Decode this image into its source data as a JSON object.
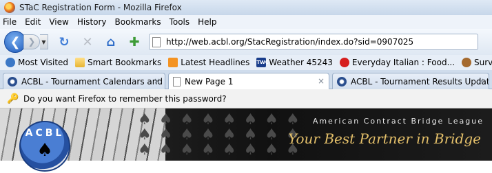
{
  "window": {
    "title": "STaC Registration Form - Mozilla Firefox"
  },
  "menu": [
    "File",
    "Edit",
    "View",
    "History",
    "Bookmarks",
    "Tools",
    "Help"
  ],
  "nav": {
    "url": "http://web.acbl.org/StacRegistration/index.do?sid=0907025"
  },
  "bookmarks": [
    {
      "label": "Most Visited",
      "icon": "most-visited-icon"
    },
    {
      "label": "Smart Bookmarks",
      "icon": "folder-icon"
    },
    {
      "label": "Latest Headlines",
      "icon": "rss-icon"
    },
    {
      "label": "Weather 45243",
      "icon": "twc-icon"
    },
    {
      "label": "Everyday Italian : Food...",
      "icon": "everyday-italian-icon"
    },
    {
      "label": "SurveyMonkey.com - ...",
      "icon": "surveymonkey-icon"
    }
  ],
  "tabs": [
    {
      "label": "ACBL - Tournament Calendars and ...",
      "close": "×"
    },
    {
      "label": "New Page 1",
      "close": "×"
    },
    {
      "label": "ACBL - Tournament Results Updates",
      "close": "×"
    }
  ],
  "notification": {
    "text": "Do you want Firefox to remember this password?"
  },
  "banner": {
    "org": "American Contract Bridge League",
    "tagline": "Your Best Partner in Bridge",
    "logo_text": "ACBL"
  }
}
